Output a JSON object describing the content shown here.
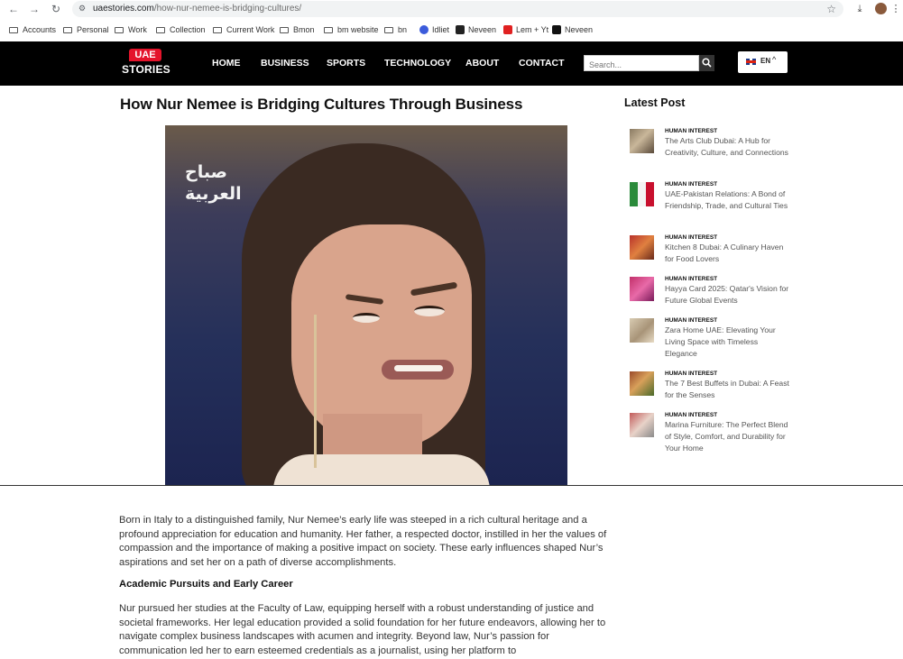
{
  "browser": {
    "url_host": "uaestories.com",
    "url_path": "/how-nur-nemee-is-bridging-cultures/",
    "bookmarks": [
      {
        "label": "Accounts",
        "type": "folder"
      },
      {
        "label": "Personal",
        "type": "folder"
      },
      {
        "label": "Work",
        "type": "folder"
      },
      {
        "label": "Collection",
        "type": "folder"
      },
      {
        "label": "Current Work",
        "type": "folder"
      },
      {
        "label": "Bmon",
        "type": "folder"
      },
      {
        "label": "bm website",
        "type": "folder"
      },
      {
        "label": "bn",
        "type": "folder"
      },
      {
        "label": "Idliet",
        "type": "site",
        "color": "#3b5bdb"
      },
      {
        "label": "Neveen",
        "type": "site",
        "color": "#222222"
      },
      {
        "label": "Lem + Yt",
        "type": "site",
        "color": "#e02020"
      },
      {
        "label": "Neveen",
        "type": "site",
        "color": "#111111"
      }
    ]
  },
  "site": {
    "logo_top": "UAE",
    "logo_bottom": "STORIES",
    "nav": [
      "HOME",
      "BUSINESS",
      "SPORTS",
      "TECHNOLOGY",
      "ABOUT",
      "CONTACT"
    ],
    "search_placeholder": "Search...",
    "lang_code": "EN",
    "colors": {
      "header_bg": "#000000",
      "brand_red": "#e4142b"
    }
  },
  "article": {
    "title": "How Nur Nemee is Bridging Cultures Through Business",
    "image_watermark_line1": "صباح",
    "image_watermark_line2": "العربية",
    "para1": "Born in Italy to a distinguished family, Nur Nemee’s early life was steeped in a rich cultural heritage and a profound appreciation for education and humanity. Her father, a respected doctor, instilled in her the values of compassion and the importance of making a positive impact on society. These early influences shaped Nur’s aspirations and set her on a path of diverse accomplishments.",
    "subhead": "Academic Pursuits and Early Career",
    "para2": "Nur pursued her studies at the Faculty of Law, equipping herself with a robust understanding of justice and societal frameworks. Her legal education provided a solid foundation for her future endeavors, allowing her to navigate complex business landscapes with acumen and integrity. Beyond law, Nur’s passion for communication led her to earn esteemed credentials as a journalist, using her platform to"
  },
  "sidebar": {
    "title": "Latest Post",
    "posts": [
      {
        "category": "HUMAN INTEREST",
        "title": "The Arts Club Dubai: A Hub for Creativity, Culture, and Connections"
      },
      {
        "category": "HUMAN INTEREST",
        "title": "UAE-Pakistan Relations: A Bond of Friendship, Trade, and Cultural Ties"
      },
      {
        "category": "HUMAN INTEREST",
        "title": "Kitchen 8 Dubai: A Culinary Haven for Food Lovers"
      },
      {
        "category": "HUMAN INTEREST",
        "title": "Hayya Card 2025: Qatar's Vision for Future Global Events"
      },
      {
        "category": "HUMAN INTEREST",
        "title": "Zara Home UAE: Elevating Your Living Space with Timeless Elegance"
      },
      {
        "category": "HUMAN INTEREST",
        "title": "The 7 Best Buffets in Dubai: A Feast for the Senses"
      },
      {
        "category": "HUMAN INTEREST",
        "title": "Marina Furniture: The Perfect Blend of Style, Comfort, and Durability for Your Home"
      }
    ]
  }
}
